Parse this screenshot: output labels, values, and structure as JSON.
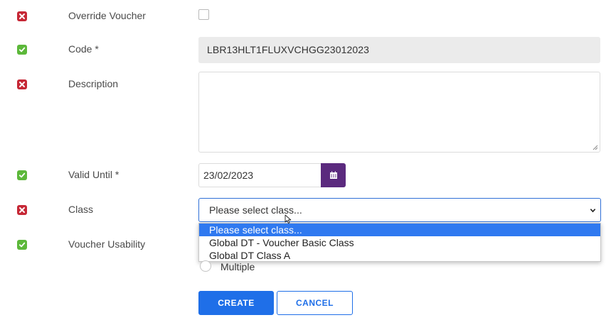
{
  "form": {
    "override_voucher": {
      "label": "Override Voucher",
      "status": "invalid",
      "checked": false
    },
    "code": {
      "label": "Code *",
      "status": "valid",
      "value": "LBR13HLT1FLUXVCHGG23012023"
    },
    "description": {
      "label": "Description",
      "status": "invalid",
      "value": ""
    },
    "valid_until": {
      "label": "Valid Until *",
      "status": "valid",
      "value": "23/02/2023",
      "icon": "calendar-icon"
    },
    "class": {
      "label": "Class",
      "status": "invalid",
      "value": "Please select class...",
      "options": [
        "Please select class...",
        "Global DT - Voucher Basic Class",
        "Global DT Class A"
      ],
      "highlighted_option": "Please select class..."
    },
    "voucher_usability": {
      "label": "Voucher Usability",
      "status": "valid",
      "visible_option": "Multiple"
    }
  },
  "actions": {
    "create_label": "CREATE",
    "cancel_label": "CANCEL"
  },
  "colors": {
    "invalid": "#c62836",
    "valid": "#5cb83a",
    "primary": "#1f6fe8",
    "calendar": "#5b2a7e",
    "option_highlight": "#2f79f0"
  }
}
